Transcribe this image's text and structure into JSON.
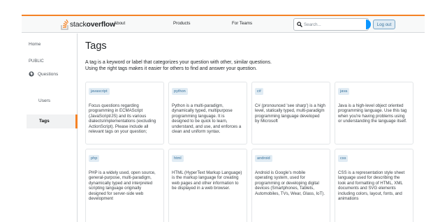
{
  "header": {
    "logo": {
      "prefix": "stack",
      "bold": "overflow"
    },
    "nav": [
      "About",
      "Products",
      "For Teams"
    ],
    "search_placeholder": "Search...",
    "logout_label": "Log out"
  },
  "sidebar": {
    "home": "Home",
    "section": "PUBLIC",
    "questions": "Questions",
    "tags": "Tags",
    "users": "Users"
  },
  "main": {
    "title": "Tags",
    "intro_line1": "A tag is a keyword or label that categorizes your question with other, similar questions.",
    "intro_line2": "Using the right tags makes it easier for others to find and answer your question."
  },
  "tags": [
    {
      "name": "javascript",
      "lines": [
        "Focus questions regarding",
        "programming in ECMAScript",
        "(JavaScript/JS) and its various",
        "dialects/implementations (excluding",
        "ActionScript). Please include all",
        "relevant tags on your question;"
      ]
    },
    {
      "name": "python",
      "lines": [
        "Python is a multi-paradigm,",
        "dynamically typed, multipurpose",
        "programming language. It is",
        "designed to be quick to learn,",
        "understand, and use, and enforces a",
        "clean and uniform syntax."
      ]
    },
    {
      "name": "c#",
      "lines": [
        "C# (pronounced 'see sharp') is a high",
        "level, statically typed, multi-paradigm",
        "programming language developed",
        "by Microsoft"
      ]
    },
    {
      "name": "java",
      "lines": [
        "Java is a high-level object oriented",
        "programming language. Use this tag",
        "when you're having problems using",
        "or understanding the language itself."
      ]
    },
    {
      "name": "php",
      "lines": [
        "PHP is a widely used, open source,",
        "general-purpose, multi-paradigm,",
        "dynamically typed and interpreted",
        "scripting language originally",
        "designed for server-side web",
        "development"
      ]
    },
    {
      "name": "html",
      "lines": [
        "HTML (HyperText Markup Language)",
        "is the markup language for creating",
        "web pages and other information to",
        "be displayed in a web browser."
      ]
    },
    {
      "name": "android",
      "lines": [
        "Android is Google's mobile",
        "operating system, used for",
        "programming or developing digital",
        "devices (Smartphones, Tablets,",
        "Automobiles, TVs, Wear, Glass, IoT)."
      ]
    },
    {
      "name": "css",
      "lines": [
        "CSS is a representation style sheet",
        "language used for describing the",
        "look and formatting of HTML, XML",
        "documents and SVG elements",
        "including colors, layout, fonts, and",
        "animations"
      ]
    }
  ],
  "colors": {
    "accent": "#f48225",
    "link": "#39739d",
    "tag_bg": "#e1ecf4",
    "toggle": "#0a95ff"
  },
  "icons": {
    "logo": "stackoverflow-logo-icon",
    "search": "search-icon",
    "questions": "globe-icon"
  }
}
